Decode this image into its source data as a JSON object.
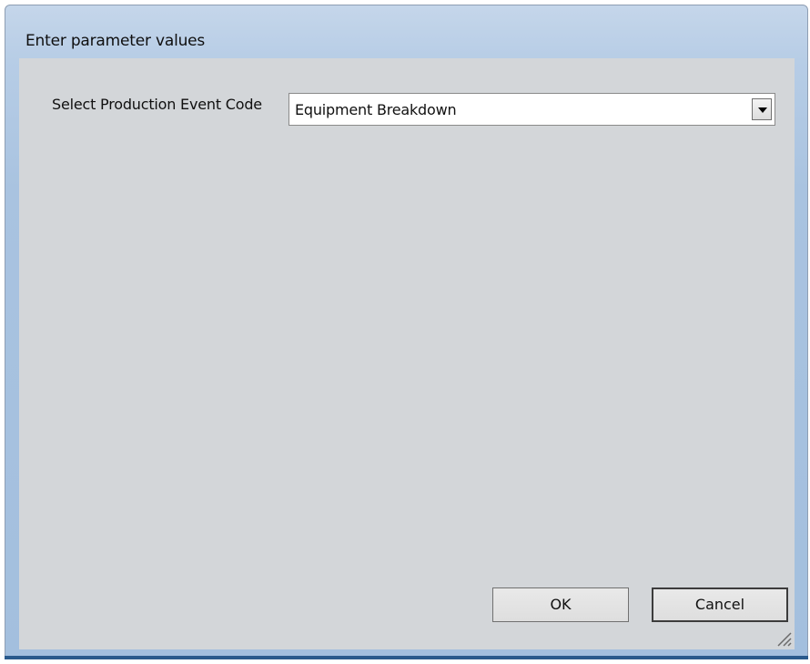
{
  "dialog": {
    "title": "Enter parameter values"
  },
  "parameters": [
    {
      "label": "Select Production Event Code",
      "selected_value": "Equipment Breakdown"
    }
  ],
  "buttons": {
    "ok_label": "OK",
    "cancel_label": "Cancel"
  },
  "icons": {
    "dropdown_arrow": "chevron-down-icon",
    "resize_grip": "resize-grip-icon"
  },
  "colors": {
    "title_bar": "#b7cde6",
    "client_background": "#d3d6d9",
    "bottom_accent": "#2a5a8c"
  }
}
